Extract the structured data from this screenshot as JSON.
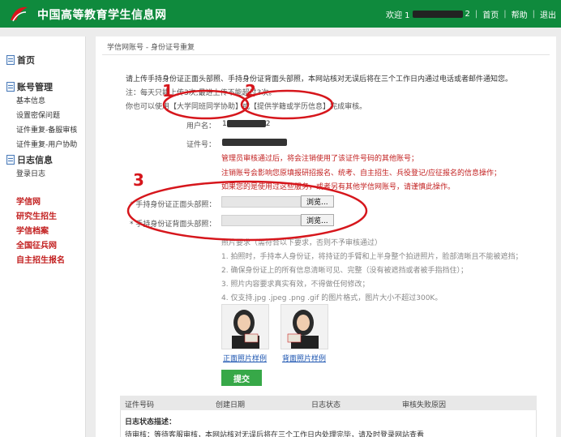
{
  "header": {
    "site_title": "中国高等教育学生信息网",
    "greeting_prefix": "欢迎 1",
    "greeting_suffix": "2",
    "nav": [
      "首页",
      "帮助",
      "退出"
    ],
    "brand_color": "#0f8a3d"
  },
  "sidebar": {
    "home": "首页",
    "account_section": "账号管理",
    "account_items": [
      "基本信息",
      "设置密保问题",
      "证件重复-备服审核",
      "证件重复-用户协助"
    ],
    "log_section": "日志信息",
    "log_items": [
      "登录日志"
    ],
    "links": [
      "学信网",
      "研究生招生",
      "学信档案",
      "全国征兵网",
      "自主招生报名"
    ]
  },
  "main": {
    "breadcrumb": "学信网账号 - 身份证号重复",
    "intro_line1": "请上传手持身份证正面头部照、手持身份证背面头部照，本网站核对无误后将在三个工作日内通过电话或者邮件通知您。",
    "intro_line2": "注：每天只能上传3次,最进上传不能超过3次。",
    "intro_line3_a": "你也可以使用",
    "link_classmate": "【大学同班同学协助】",
    "intro_or": "或",
    "link_academic": "【提供学籍或学历信息】",
    "intro_line3_b": "完成审核。",
    "username_label": "用户名：",
    "username_prefix": "1",
    "username_suffix": "2",
    "id_label": "证件号：",
    "warning_lines": [
      "管理员审核通过后，将会注销使用了该证件号码的其他账号；",
      "注销账号会影响您原填报研招报名、统考、自主招生、兵役登记/应征报名的信息操作；",
      "如果您的是使用过这些服务，或者另有其他学信网账号，请谨慎此操作。"
    ],
    "front_label": "* 手持身份证正面头部照：",
    "back_label": "* 手持身份证背面头部照：",
    "browse_label": "浏览...",
    "req_title": "照片要求（需符合以下要求，否则不予审核通过）",
    "requirements": [
      "1. 拍照时，手持本人身份证，将持证的手臂和上半身整个拍进照片，脸部清晰且不能被遮挡；",
      "2. 确保身份证上的所有信息清晰可见、完整（没有被遮挡或者被手指挡住）；",
      "3. 照片内容要求真实有效，不得做任何修改；",
      "4. 仅支持.jpg .jpeg .png .gif 的图片格式，图片大小不超过300K。"
    ],
    "sample_front": "正面照片样例",
    "sample_back": "背面照片样例",
    "submit_label": "提交",
    "table_headers": [
      "证件号码",
      "创建日期",
      "日志状态",
      "审核失败原因"
    ],
    "log_desc_title": "日志状态描述：",
    "log_desc_line": "待审核：等待客服审核，本网站核对无误后将在三个工作日内处理完毕，请及时登录网站查看"
  },
  "annotations": [
    "1",
    "2",
    "3"
  ],
  "annotation_color": "#d6161c"
}
